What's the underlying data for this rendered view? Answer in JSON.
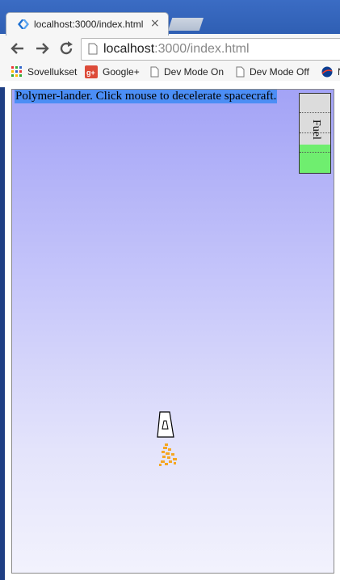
{
  "browser": {
    "tab_title": "localhost:3000/index.html",
    "tab_close": "×",
    "url_host": "localhost",
    "url_path": ":3000/index.html",
    "icons": {
      "back": "arrow-left-icon",
      "forward": "arrow-right-icon",
      "reload": "reload-icon",
      "page": "page-icon"
    },
    "bookmarks": [
      {
        "label": "Sovellukset",
        "icon": "apps-grid-icon"
      },
      {
        "label": "Google+",
        "icon": "google-plus-icon"
      },
      {
        "label": "Dev Mode On",
        "icon": "page-icon"
      },
      {
        "label": "Dev Mode Off",
        "icon": "page-icon"
      },
      {
        "label": "N",
        "icon": "nasa-icon"
      }
    ]
  },
  "game": {
    "instructions": "Polymer-lander. Click mouse to decelerate spacecraft.",
    "fuel_label": "Fuel",
    "fuel_fraction": 0.36,
    "colors": {
      "sky_top": "#a3a3f6",
      "sky_bottom": "#f2f2fd",
      "fuel_fill": "#6fee6f",
      "flame": "#f5a623",
      "highlight": "#4c8ef5"
    }
  }
}
